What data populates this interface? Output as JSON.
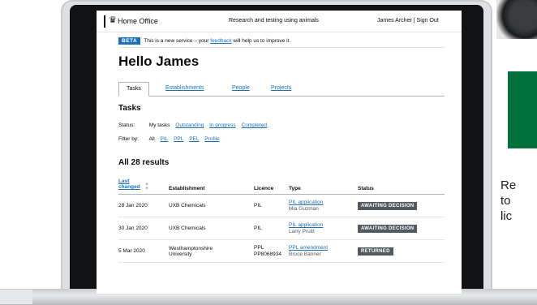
{
  "header": {
    "brand": "Home Office",
    "service_name": "Research and testing using animals",
    "user_name": "James Archer",
    "separator": "|",
    "sign_out": "Sign Out"
  },
  "beta": {
    "tag": "BETA",
    "text_before": "This is a new service – your ",
    "link": "feedback",
    "text_after": " will help us to improve it."
  },
  "page_title": "Hello James",
  "tabs": [
    "Tasks",
    "Establishments",
    "People",
    "Projects"
  ],
  "tasks_heading": "Tasks",
  "status_filter": {
    "label": "Status:",
    "current": "My tasks",
    "options": [
      "Outstanding",
      "In progress",
      "Completed"
    ]
  },
  "type_filter": {
    "label": "Filter by:",
    "current": "All",
    "options": [
      "PIL",
      "PPL",
      "PEL",
      "Profile"
    ]
  },
  "results_heading": "All 28 results",
  "table": {
    "columns": [
      "Last changed",
      "Establishment",
      "Licence",
      "Type",
      "Status"
    ],
    "rows": [
      {
        "date": "28 Jan 2020",
        "establishment": "UXB Chemicals",
        "licence": "PIL",
        "licence_no": "",
        "type": "PIL application",
        "person": "Mia Guzman",
        "status": "AWAITING DECISION"
      },
      {
        "date": "30 Jan 2020",
        "establishment": "UXB Chemicals",
        "licence": "PIL",
        "licence_no": "",
        "type": "PIL application",
        "person": "Larry Pruitt",
        "status": "AWAITING DECISION"
      },
      {
        "date": "5 Mar 2020",
        "establishment": "Westhamptonshire University",
        "licence": "PPL",
        "licence_no": "PP8068934",
        "type": "PPL amendment",
        "person": "Bruce Banner",
        "status": "RETURNED"
      }
    ]
  },
  "side_text": [
    "Re",
    "to",
    "lic"
  ],
  "colors": {
    "link": "#1d70b8",
    "badge": "#505a5f",
    "green": "#00703c"
  },
  "icons": {
    "crest": "crest-icon"
  }
}
